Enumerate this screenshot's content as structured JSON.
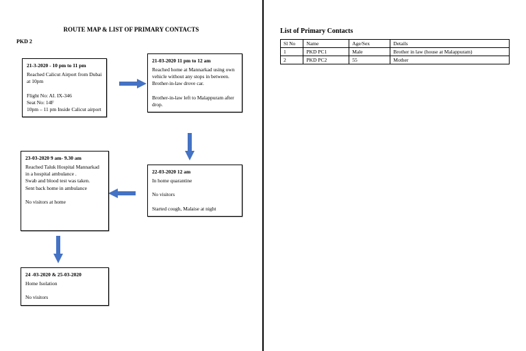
{
  "left": {
    "title": "ROUTE MAP & LIST OF PRIMARY CONTACTS",
    "case_id": "PKD 2",
    "boxes": {
      "b1": {
        "header": "21-3-2020    - 10 pm to 11 pm",
        "body": "Reached Calicut Airport from Dubai at 10pm\n\nFlight No: AI. IX-346\nSeat No: 14F\n10pm – 11 pm Inside Calicut airport"
      },
      "b2": {
        "header": "21-03-2020   11  pm to  12 am",
        "body": "Reached home at Mannarkad using own vehicle  without any stops in between. Brother-in-law drove car.\n\nBrother-in-law left to Malappuram after drop."
      },
      "b3": {
        "header": "22-03-2020 12 am",
        "body": "In home quarantine\n\nNo visitors\n\nStarted cough, Malaise at night"
      },
      "b4": {
        "header": "23-03-2020  9 am- 9.30 am",
        "body": "Reached  Taluk Hospital Mannarkad  in a hospital ambulance .\nSwab and blood test was taken.\nSent back home in ambulance\n\nNo visitors at home"
      },
      "b5": {
        "header": "24 -03-2020 & 25-03-2020",
        "body": "Home Isolation\n\nNo visitors"
      }
    }
  },
  "right": {
    "list_title": "List of Primary Contacts",
    "headers": {
      "c1": "Sl No",
      "c2": "Name",
      "c3": "Age/Sex",
      "c4": "Details"
    },
    "rows": [
      {
        "c1": "1",
        "c2": "PKD PC1",
        "c3": "Male",
        "c4": "Brother in law (house at Malappuram)"
      },
      {
        "c1": "2",
        "c2": "PKD PC2",
        "c3": "55",
        "c4": "Mother"
      }
    ]
  }
}
